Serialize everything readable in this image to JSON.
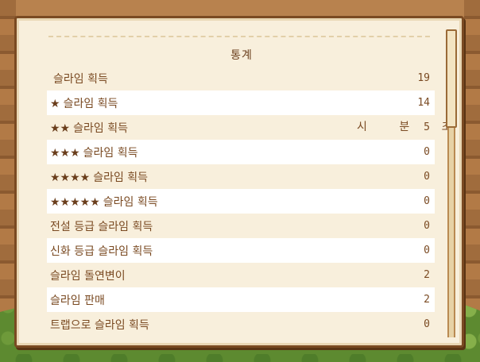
{
  "title": "통계",
  "overlay_text": "시 분 초",
  "rows": [
    {
      "stars": "",
      "label": "슬라임 획득",
      "value": "19"
    },
    {
      "stars": "★",
      "label": "슬라임 획득",
      "value": "14"
    },
    {
      "stars": "★★",
      "label": "슬라임 획득",
      "value": "5"
    },
    {
      "stars": "★★★",
      "label": "슬라임 획득",
      "value": "0"
    },
    {
      "stars": "★★★★",
      "label": "슬라임 획득",
      "value": "0"
    },
    {
      "stars": "★★★★★",
      "label": "슬라임 획득",
      "value": "0"
    },
    {
      "stars": "",
      "label": "전설 등급 슬라임 획득",
      "value": "0"
    },
    {
      "stars": "",
      "label": "신화 등급 슬라임 획득",
      "value": "0"
    },
    {
      "stars": "",
      "label": "슬라임 돌연변이",
      "value": "2"
    },
    {
      "stars": "",
      "label": "슬라임 판매",
      "value": "2"
    },
    {
      "stars": "",
      "label": "트랩으로 슬라임 획득",
      "value": "0"
    }
  ]
}
